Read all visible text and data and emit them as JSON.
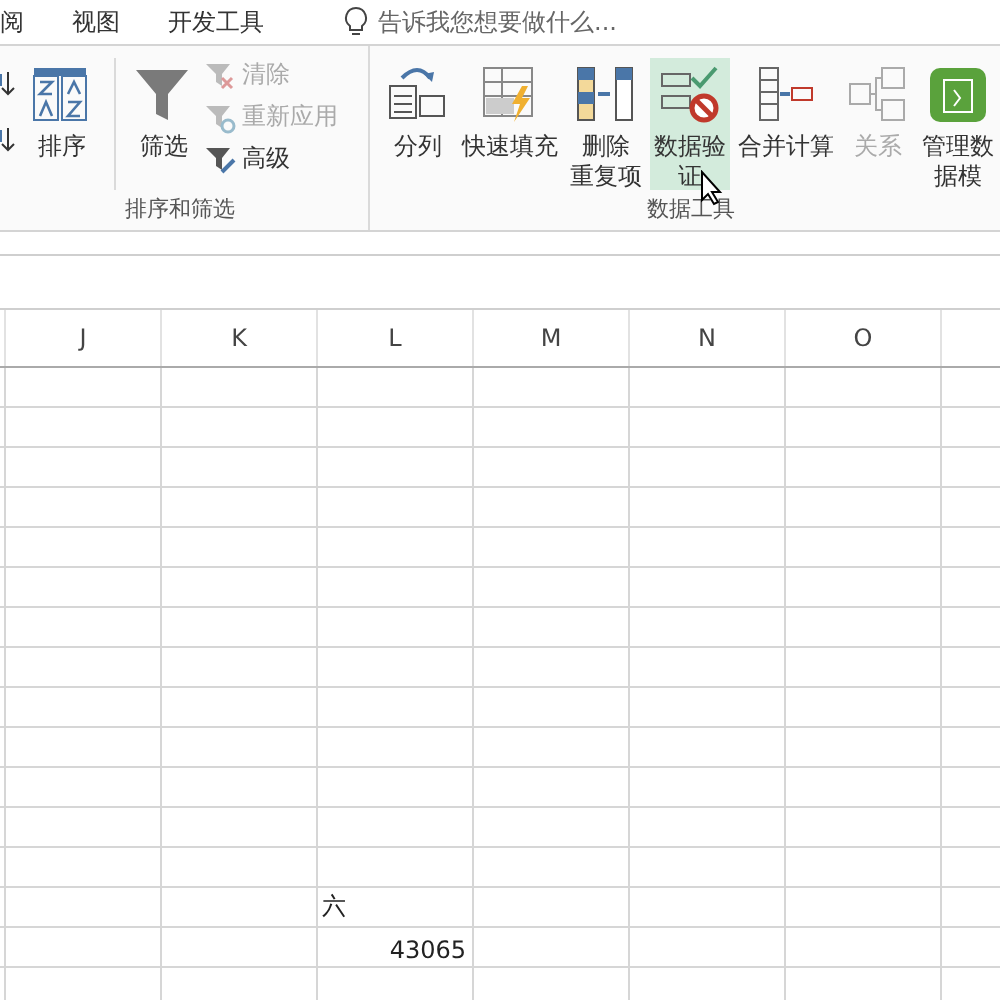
{
  "tabs": [
    {
      "label": "阅",
      "selected": false
    },
    {
      "label": "视图",
      "selected": false
    },
    {
      "label": "开发工具",
      "selected": false
    }
  ],
  "tell_me": {
    "placeholder": "告诉我您想要做什么..."
  },
  "groups": [
    {
      "label": "排序和筛选",
      "items": [
        {
          "kind": "sortstack"
        },
        {
          "kind": "large",
          "label": [
            "排序"
          ],
          "disabled": false,
          "highlighted": false
        },
        {
          "kind": "large",
          "label": [
            "筛选"
          ],
          "disabled": false,
          "highlighted": false
        },
        {
          "kind": "small",
          "items": [
            {
              "label": "清除",
              "disabled": true
            },
            {
              "label": "重新应用",
              "disabled": true
            },
            {
              "label": "高级",
              "disabled": false
            }
          ]
        }
      ]
    },
    {
      "label": "数据工具",
      "items": [
        {
          "kind": "large",
          "label": [
            "分列"
          ],
          "disabled": false,
          "highlighted": false
        },
        {
          "kind": "large",
          "label": [
            "快速填充"
          ],
          "disabled": false,
          "highlighted": false
        },
        {
          "kind": "large",
          "label": [
            "删除",
            "重复项"
          ],
          "disabled": false,
          "highlighted": false
        },
        {
          "kind": "large",
          "label": [
            "数据验",
            "证"
          ],
          "disabled": false,
          "highlighted": true
        },
        {
          "kind": "large",
          "label": [
            "合并计算"
          ],
          "disabled": false,
          "highlighted": false
        },
        {
          "kind": "large",
          "label": [
            "关系"
          ],
          "disabled": true,
          "highlighted": false
        },
        {
          "kind": "large",
          "label": [
            "管理数",
            "据模"
          ],
          "disabled": false,
          "highlighted": false
        }
      ]
    }
  ],
  "columns": [
    "J",
    "K",
    "L",
    "M",
    "N",
    "O"
  ],
  "cells": [
    {
      "text": "六",
      "kind": "text"
    },
    {
      "text": "43065",
      "kind": "number"
    }
  ]
}
